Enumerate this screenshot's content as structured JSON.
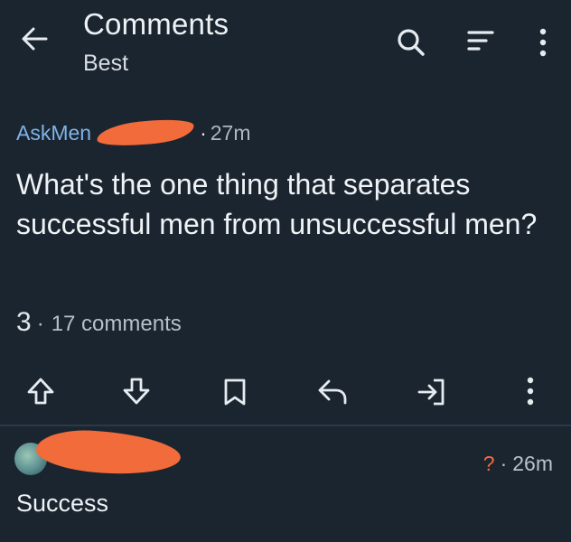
{
  "header": {
    "title": "Comments",
    "sort_label": "Best"
  },
  "post": {
    "subreddit": "AskMen",
    "age": "27m",
    "title": "What's the one thing that separates successful men from unsuccessful men?",
    "score": "3",
    "comment_count": "17 comments"
  },
  "comment": {
    "score": "?",
    "age": "26m",
    "body": "Success"
  },
  "icons": {
    "header": [
      "back-arrow-icon",
      "search-icon",
      "sort-icon",
      "more-vertical-icon"
    ],
    "actions": [
      "upvote-icon",
      "downvote-icon",
      "bookmark-icon",
      "reply-icon",
      "share-icon",
      "more-vertical-icon"
    ]
  },
  "colors": {
    "background": "#1a2530",
    "subreddit_link": "#7fb3e6",
    "redaction": "#f26b3a",
    "divider": "#2c3945"
  }
}
